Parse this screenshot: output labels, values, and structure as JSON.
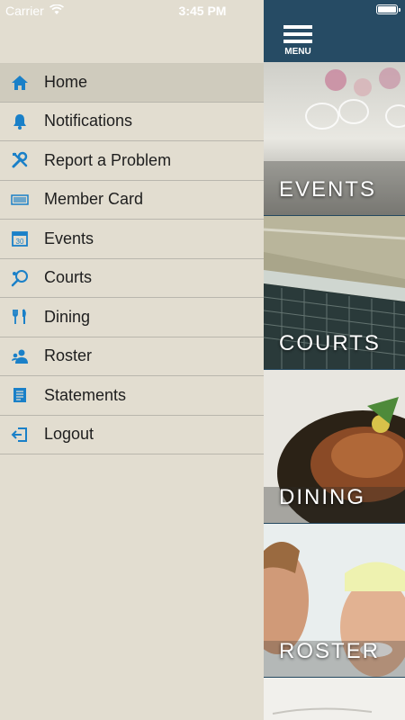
{
  "status_bar": {
    "carrier": "Carrier",
    "time": "3:45 PM"
  },
  "header": {
    "menu_label": "MENU"
  },
  "drawer": {
    "items": [
      {
        "label": "Home",
        "icon": "home-icon"
      },
      {
        "label": "Notifications",
        "icon": "bell-icon"
      },
      {
        "label": "Report a Problem",
        "icon": "tools-icon"
      },
      {
        "label": "Member Card",
        "icon": "barcode-icon"
      },
      {
        "label": "Events",
        "icon": "calendar-icon",
        "calendar_number": "30"
      },
      {
        "label": "Courts",
        "icon": "tennis-racket-icon"
      },
      {
        "label": "Dining",
        "icon": "utensils-icon"
      },
      {
        "label": "Roster",
        "icon": "people-icon"
      },
      {
        "label": "Statements",
        "icon": "document-icon"
      },
      {
        "label": "Logout",
        "icon": "logout-icon"
      }
    ],
    "active_index": 0
  },
  "tiles": [
    {
      "label": "EVENTS"
    },
    {
      "label": "COURTS"
    },
    {
      "label": "DINING"
    },
    {
      "label": "ROSTER"
    }
  ],
  "colors": {
    "accent": "#1a80c8",
    "drawer_bg": "#e2ddd0",
    "active_bg": "#cfcbbd",
    "topbar": "#264b64"
  }
}
